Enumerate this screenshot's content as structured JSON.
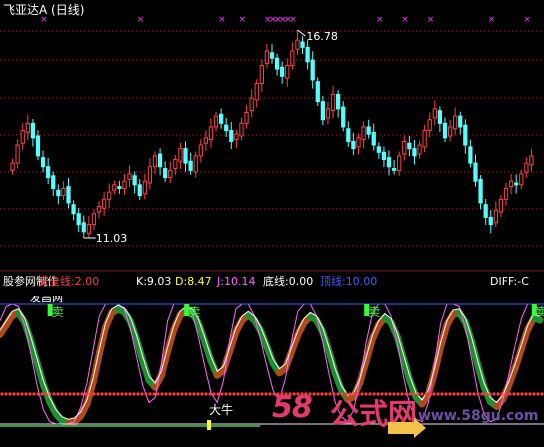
{
  "top_panel": {
    "title": "飞亚达A (日线)",
    "high_label": "16.78",
    "low_label": "11.03"
  },
  "indicator_panel": {
    "name": "股参网制作",
    "values": [
      {
        "label": "安全线:2.00",
        "color": "#ff3b3b"
      },
      {
        "label": "K:9.03",
        "color": "#ffffff"
      },
      {
        "label": "D:8.47",
        "color": "#ffff33"
      },
      {
        "label": "J:10.14",
        "color": "#ff66ff"
      },
      {
        "label": "底线:0.00",
        "color": "#ffffff"
      },
      {
        "label": "顶线:10.00",
        "color": "#3d5bff"
      }
    ],
    "diff_label": "DIFF:-C",
    "sell_label": "卖",
    "bull_label": "大牛",
    "partial_label": "发昌网"
  },
  "watermark": {
    "num": "58",
    "cn": "公式网",
    "url": "www.58gu.com"
  },
  "colors": {
    "up": "#ff4040",
    "down": "#54ffff",
    "grid": "#b02020",
    "cross": "#ff33ff",
    "k_line": "#ffffff",
    "j_line": "#ff66ff",
    "top_line": "#3d5bff",
    "bottom_line": "#ff3b3b",
    "band_green": "#1f8f2f",
    "band_brown": "#b04a18",
    "sell_green": "#33ff33"
  },
  "chart_data": [
    {
      "type": "candlestick",
      "title": "飞亚达A (日线)",
      "annotations": [
        {
          "text": "16.78",
          "kind": "high"
        },
        {
          "text": "11.03",
          "kind": "low"
        }
      ],
      "closes": [
        13.1,
        13.6,
        14.0,
        14.2,
        13.8,
        13.3,
        13.0,
        12.7,
        12.4,
        12.2,
        12.4,
        12.0,
        11.7,
        11.4,
        11.2,
        11.4,
        11.7,
        11.9,
        12.1,
        12.3,
        12.5,
        12.4,
        12.6,
        12.8,
        12.5,
        12.2,
        12.6,
        13.0,
        13.3,
        13.0,
        12.7,
        12.9,
        13.2,
        13.5,
        13.1,
        12.9,
        13.3,
        13.6,
        13.8,
        14.1,
        14.4,
        14.2,
        14.0,
        13.7,
        13.9,
        14.2,
        14.5,
        14.9,
        15.3,
        15.8,
        16.2,
        16.0,
        15.7,
        15.5,
        15.8,
        16.2,
        16.5,
        16.3,
        15.9,
        15.4,
        14.8,
        14.3,
        14.6,
        15.0,
        14.6,
        14.1,
        13.7,
        13.5,
        13.8,
        14.1,
        13.9,
        13.6,
        13.4,
        13.2,
        13.0,
        12.9,
        13.3,
        13.7,
        13.5,
        13.3,
        13.6,
        14.0,
        14.3,
        14.6,
        14.2,
        13.8,
        14.1,
        14.4,
        14.1,
        13.6,
        13.1,
        12.6,
        12.0,
        11.6,
        11.4,
        11.8,
        12.1,
        12.4,
        12.6,
        12.5,
        12.8,
        13.1,
        13.3
      ]
    },
    {
      "type": "line",
      "title": "股参网制作",
      "series": [
        {
          "name": "K",
          "values": [
            7.8,
            8.6,
            9.4,
            9.6,
            8.8,
            7.2,
            5.4,
            3.6,
            2.2,
            1.2,
            0.6,
            0.4,
            0.5,
            1.0,
            2.0,
            3.8,
            6.2,
            8.4,
            9.6,
            9.9,
            9.7,
            8.9,
            7.4,
            5.6,
            4.0,
            3.4,
            4.4,
            6.4,
            8.2,
            9.4,
            9.8,
            9.6,
            8.7,
            7.2,
            5.6,
            4.4,
            4.8,
            6.4,
            8.0,
            9.0,
            9.4,
            9.0,
            8.1,
            6.8,
            5.4,
            4.6,
            5.0,
            6.4,
            7.8,
            8.8,
            9.3,
            9.0,
            8.0,
            6.4,
            4.6,
            3.2,
            2.4,
            2.6,
            3.8,
            5.6,
            7.4,
            8.6,
            9.2,
            8.8,
            7.6,
            5.8,
            4.0,
            2.6,
            2.0,
            2.8,
            4.6,
            6.8,
            8.6,
            9.5,
            9.6,
            8.8,
            7.2,
            5.2,
            3.4,
            2.2,
            1.8,
            2.4,
            3.6,
            5.0,
            6.6,
            8.2,
            9.2,
            9.0
          ]
        },
        {
          "name": "J",
          "values": [
            8.6,
            9.8,
            10.0,
            9.8,
            8.2,
            5.8,
            3.2,
            1.2,
            0.2,
            0.0,
            0.0,
            0.0,
            0.2,
            1.4,
            3.4,
            6.2,
            9.0,
            10.0,
            10.0,
            10.0,
            9.6,
            8.0,
            5.6,
            3.2,
            1.8,
            2.2,
            5.0,
            8.6,
            10.0,
            10.0,
            10.0,
            9.2,
            7.2,
            4.8,
            2.6,
            1.8,
            3.6,
            7.0,
            9.6,
            10.0,
            10.0,
            9.0,
            7.0,
            4.8,
            2.8,
            2.0,
            3.8,
            7.0,
            9.4,
            10.0,
            10.0,
            9.0,
            6.8,
            4.2,
            1.8,
            0.6,
            0.2,
            1.2,
            3.8,
            6.8,
            9.2,
            10.0,
            10.0,
            9.0,
            6.8,
            4.0,
            1.6,
            0.4,
            0.2,
            1.8,
            5.0,
            8.4,
            10.0,
            10.0,
            9.8,
            8.0,
            5.4,
            2.6,
            0.8,
            0.2,
            0.4,
            2.0,
            4.2,
            6.6,
            8.8,
            10.0,
            10.0,
            9.4
          ]
        }
      ],
      "reference_lines": [
        {
          "name": "安全线",
          "value": 2.0
        },
        {
          "name": "底线",
          "value": 0.0
        },
        {
          "name": "顶线",
          "value": 10.0
        }
      ],
      "signals": [
        {
          "text": "卖",
          "index": 8
        },
        {
          "text": "卖",
          "index": 30
        },
        {
          "text": "卖",
          "index": 59
        },
        {
          "text": "卖",
          "index": 86
        },
        {
          "text": "大牛",
          "index": 34
        }
      ]
    }
  ]
}
